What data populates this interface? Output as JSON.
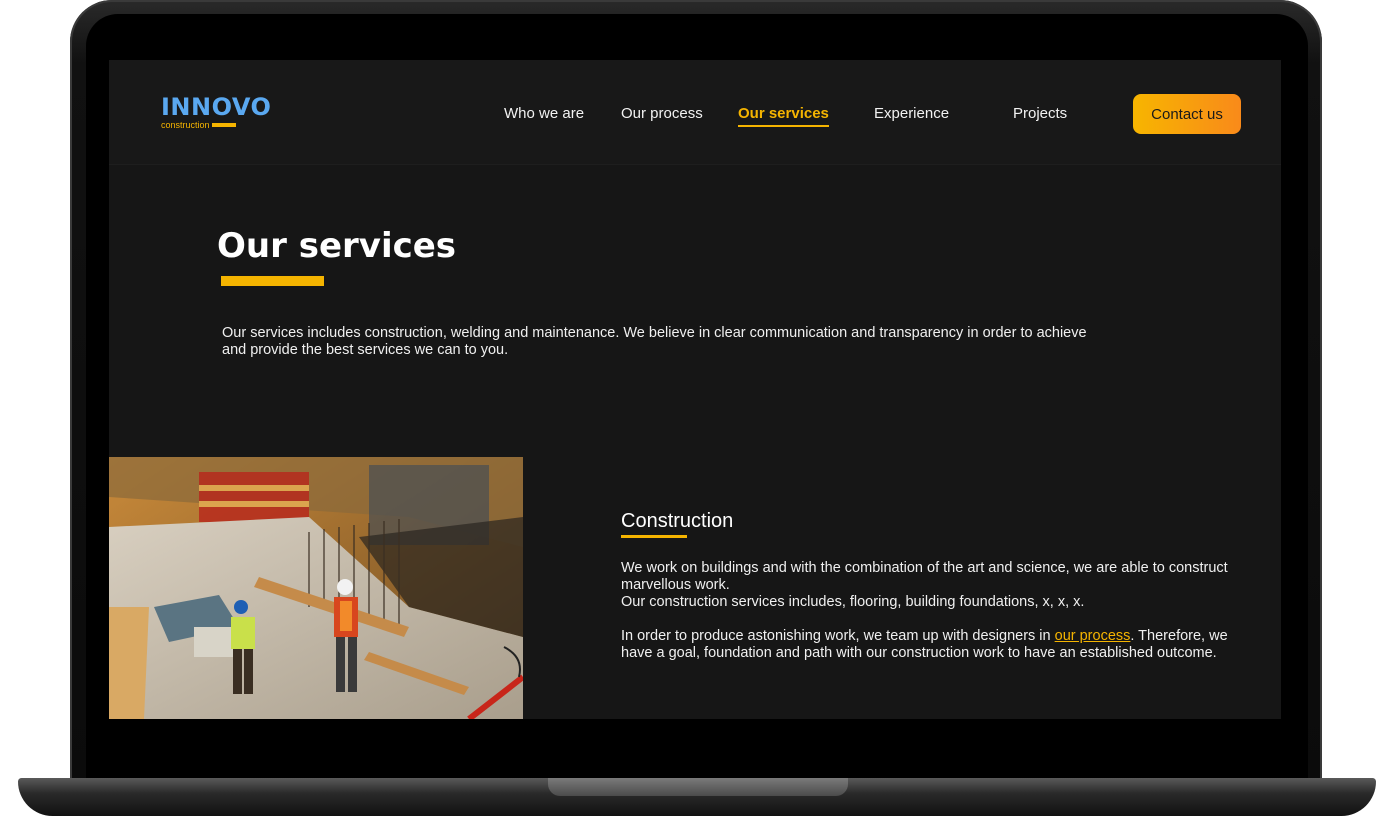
{
  "logo": {
    "main": "INNOVO",
    "sub": "construction"
  },
  "nav": {
    "items": [
      {
        "label": "Who we are"
      },
      {
        "label": "Our process"
      },
      {
        "label": "Our services",
        "active": true
      },
      {
        "label": "Experience"
      },
      {
        "label": "Projects"
      }
    ],
    "contact_label": "Contact us"
  },
  "main": {
    "title": "Our services",
    "intro": "Our services includes construction, welding and maintenance. We believe in clear communication and transparency in order to achieve and provide the best services we can to you."
  },
  "construction": {
    "title": "Construction",
    "p1": "We work on buildings and with the combination of the art and science, we are able to construct marvellous work.",
    "p2": "Our construction services includes, flooring, building foundations, x, x, x.",
    "p3_before": "In order to produce astonishing work, we team up with designers in ",
    "p3_link": "our process",
    "p3_after": ". Therefore, we have a goal, foundation and path with our construction work to have an established outcome.",
    "photo_icon": "construction-site-photo"
  },
  "colors": {
    "accent": "#f5b400",
    "logo": "#5aa8f0",
    "background": "#161616",
    "button_gradient_end": "#f98a1a"
  }
}
